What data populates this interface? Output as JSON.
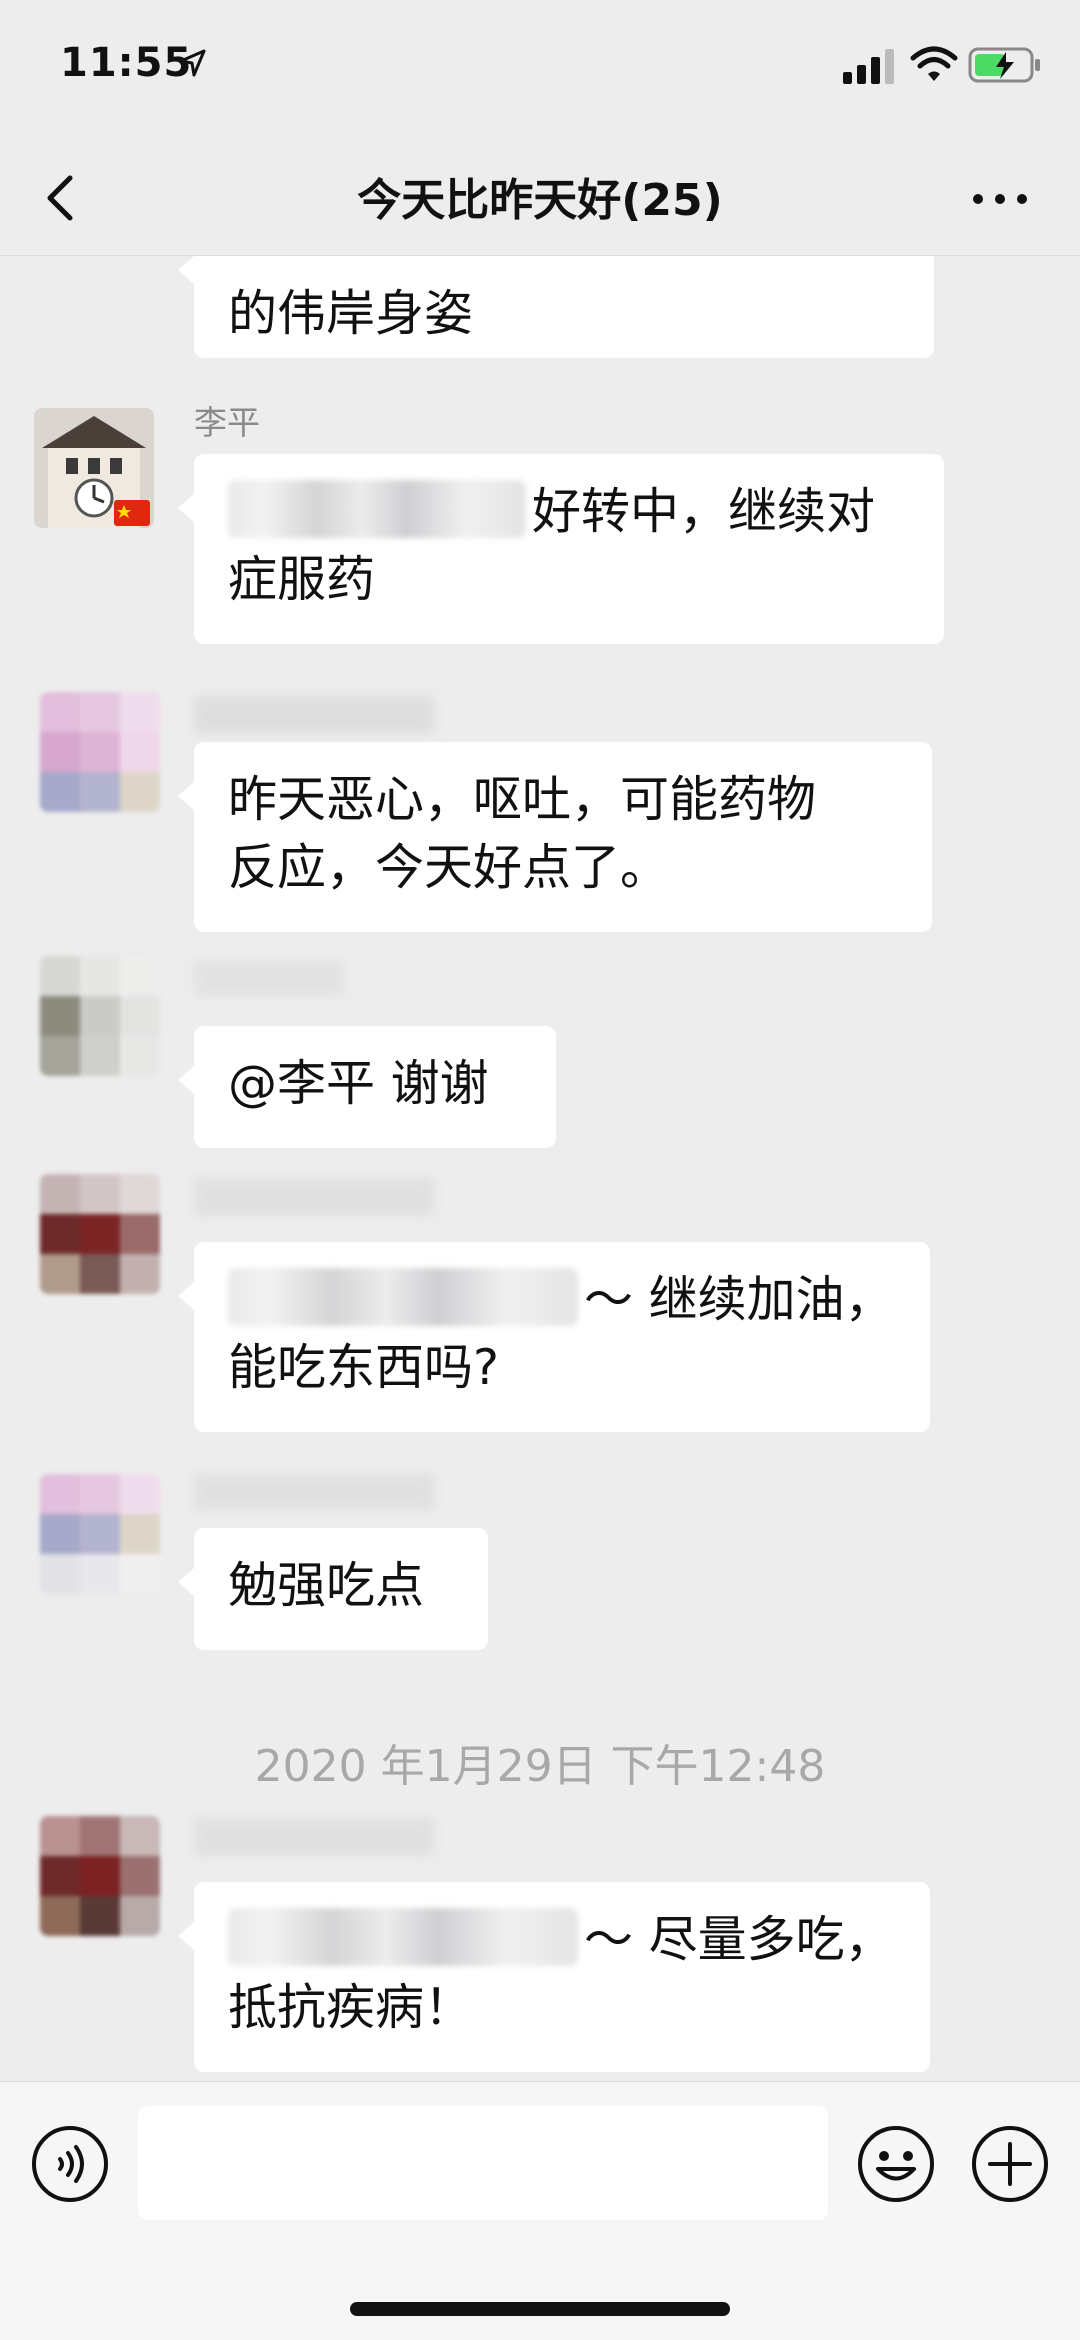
{
  "status_bar": {
    "time": "11:55",
    "location_icon": "location-arrow-icon",
    "signal_icon": "cellular-signal-icon",
    "wifi_icon": "wifi-icon",
    "battery_icon": "battery-charging-icon"
  },
  "header": {
    "title": "今天比昨天好(25)",
    "back_icon": "chevron-left-icon",
    "more_icon": "more-dots-icon"
  },
  "messages": [
    {
      "sender": "",
      "text_lines": [
        "的伟岸身姿"
      ]
    },
    {
      "sender": "李平",
      "tail_line1": "好转中，继续对",
      "line2": "症服药"
    },
    {
      "sender": "",
      "text_lines": [
        "昨天恶心，呕吐，可能药物",
        "反应，今天好点了。"
      ]
    },
    {
      "sender": "",
      "text_lines": [
        "@李平 谢谢"
      ]
    },
    {
      "sender": "",
      "tail_line1": "～ 继续加油，",
      "line2": "能吃东西吗?"
    },
    {
      "sender": "",
      "text_lines": [
        "勉强吃点"
      ]
    },
    {
      "sender": "",
      "tail_line1": "～ 尽量多吃，",
      "line2": "抵抗疾病！"
    }
  ],
  "timestamp": "2020 年1月29日 下午12:48",
  "input_bar": {
    "voice_icon": "voice-input-icon",
    "emoji_icon": "emoji-icon",
    "plus_icon": "plus-circle-icon",
    "input_value": ""
  },
  "colors": {
    "background": "#ededed",
    "bubble": "#ffffff",
    "meta_text": "#8a8a8a"
  }
}
